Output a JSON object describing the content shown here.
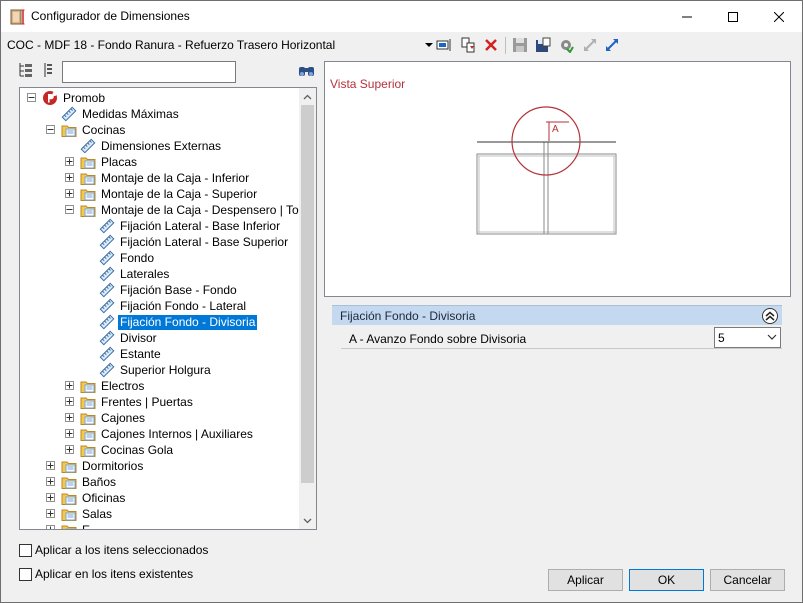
{
  "window": {
    "title": "Configurador de Dimensiones",
    "controls": {
      "minimize": "minimize-icon",
      "maximize": "maximize-icon",
      "close": "close-icon"
    }
  },
  "toolbar": {
    "config_name": "COC - MDF 18 - Fondo Ranura - Refuerzo Trasero Horizontal",
    "icons": [
      "dropdown-arrow-icon",
      "select-object-icon",
      "copy-icon",
      "delete-icon",
      "save-icon",
      "save-as-icon",
      "settings-icon",
      "expand-arrows-icon",
      "collapse-arrows-icon"
    ]
  },
  "search": {
    "placeholder": "",
    "value": ""
  },
  "tree": {
    "items": [
      {
        "label": "Promob",
        "level": 0,
        "expanded": true,
        "icon": "promob-icon"
      },
      {
        "label": "Medidas Máximas",
        "level": 1,
        "icon": "ruler-icon"
      },
      {
        "label": "Cocinas",
        "level": 1,
        "expanded": true,
        "icon": "folder-icon"
      },
      {
        "label": "Dimensiones Externas",
        "level": 2,
        "icon": "ruler-icon"
      },
      {
        "label": "Placas",
        "level": 2,
        "expanded": false,
        "icon": "folder-icon"
      },
      {
        "label": "Montaje de la Caja - Inferior",
        "level": 2,
        "expanded": false,
        "icon": "folder-icon"
      },
      {
        "label": "Montaje de la Caja - Superior",
        "level": 2,
        "expanded": false,
        "icon": "folder-icon"
      },
      {
        "label": "Montaje de la Caja - Despensero | Torres",
        "level": 2,
        "expanded": true,
        "icon": "folder-icon"
      },
      {
        "label": "Fijación Lateral - Base Inferior",
        "level": 3,
        "icon": "ruler-icon"
      },
      {
        "label": "Fijación Lateral - Base Superior",
        "level": 3,
        "icon": "ruler-icon"
      },
      {
        "label": "Fondo",
        "level": 3,
        "icon": "ruler-icon"
      },
      {
        "label": "Laterales",
        "level": 3,
        "icon": "ruler-icon"
      },
      {
        "label": " Fijación Base - Fondo",
        "level": 3,
        "icon": "ruler-icon"
      },
      {
        "label": "Fijación Fondo - Lateral",
        "level": 3,
        "icon": "ruler-icon"
      },
      {
        "label": "Fijación Fondo - Divisoria",
        "level": 3,
        "icon": "ruler-icon",
        "selected": true
      },
      {
        "label": "Divisor",
        "level": 3,
        "icon": "ruler-icon"
      },
      {
        "label": "Estante",
        "level": 3,
        "icon": "ruler-icon"
      },
      {
        "label": "Superior Holgura",
        "level": 3,
        "icon": "ruler-icon"
      },
      {
        "label": "Electros",
        "level": 2,
        "expanded": false,
        "icon": "folder-icon"
      },
      {
        "label": "Frentes | Puertas",
        "level": 2,
        "expanded": false,
        "icon": "folder-icon"
      },
      {
        "label": "Cajones",
        "level": 2,
        "expanded": false,
        "icon": "folder-icon"
      },
      {
        "label": "Cajones Internos | Auxiliares",
        "level": 2,
        "expanded": false,
        "icon": "folder-icon"
      },
      {
        "label": "Cocinas Gola",
        "level": 2,
        "expanded": false,
        "icon": "folder-icon"
      },
      {
        "label": "Dormitorios",
        "level": 1,
        "expanded": false,
        "icon": "folder-icon"
      },
      {
        "label": "Baños",
        "level": 1,
        "expanded": false,
        "icon": "folder-icon"
      },
      {
        "label": "Oficinas",
        "level": 1,
        "expanded": false,
        "icon": "folder-icon"
      },
      {
        "label": "Salas",
        "level": 1,
        "expanded": false,
        "icon": "folder-icon"
      },
      {
        "label": "E...",
        "level": 1,
        "expanded": false,
        "icon": "folder-icon"
      }
    ]
  },
  "preview": {
    "title": "Vista Superior",
    "dimension_label": "A"
  },
  "properties": {
    "group_title": "Fijación Fondo - Divisoria",
    "rows": [
      {
        "label": "A - Avanzo Fondo sobre Divisoria",
        "value": "5"
      }
    ]
  },
  "options": {
    "apply_selected": "Aplicar a los itens seleccionados",
    "apply_existing": "Aplicar en los itens existentes"
  },
  "buttons": {
    "apply": "Aplicar",
    "ok": "OK",
    "cancel": "Cancelar"
  },
  "colors": {
    "accent": "#0078d7",
    "preview_title": "#b5323a",
    "group_header": "#c4d8ef"
  }
}
